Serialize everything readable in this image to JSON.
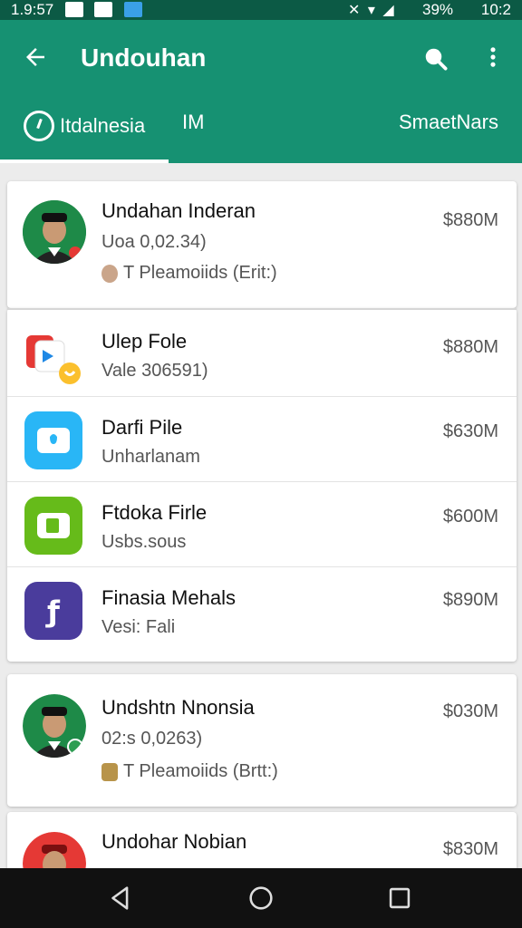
{
  "status_bar": {
    "time_left": "1.9:57",
    "battery": "39%",
    "time_right": "10:2"
  },
  "app_bar": {
    "title": "Undouhan",
    "tabs": [
      {
        "label": "Itdalnesia"
      },
      {
        "label": "IM"
      },
      {
        "label": "SmaetNars"
      }
    ]
  },
  "cards": [
    {
      "rows": [
        {
          "name": "Undahan Inderan",
          "sub": "Uoa 0,02.34)",
          "sub2": "T Pleamoiids (Erit:)",
          "price": "$880M"
        }
      ]
    },
    {
      "rows": [
        {
          "name": "Ulep Fole",
          "sub": "Vale 306591)",
          "price": "$880M"
        },
        {
          "name": "Darfi Pile",
          "sub": "Unharlanam",
          "price": "$630M"
        },
        {
          "name": "Ftdoka Firle",
          "sub": "Usbs.sous",
          "price": "$600M"
        },
        {
          "name": "Finasia Mehals",
          "sub": "Vesi: Fali",
          "price": "$890M"
        }
      ]
    },
    {
      "rows": [
        {
          "name": "Undshtn Nnonsia",
          "sub": "02:s 0,0263)",
          "sub2": "T Pleamoiids (Brtt:)",
          "price": "$030M"
        }
      ]
    },
    {
      "rows": [
        {
          "name": "Undohar Nobian",
          "price": "$830M"
        }
      ]
    }
  ],
  "colors": {
    "app_bar": "#169172",
    "status_bar": "#0c5a45",
    "icon_red": "#e53935",
    "icon_blue": "#29b6f6",
    "icon_green": "#66bb1a",
    "icon_purple": "#4a3c9c"
  },
  "icons": {
    "back": "arrow-left-icon",
    "search": "search-icon",
    "more": "more-vert-icon",
    "tab": "clock-icon"
  }
}
